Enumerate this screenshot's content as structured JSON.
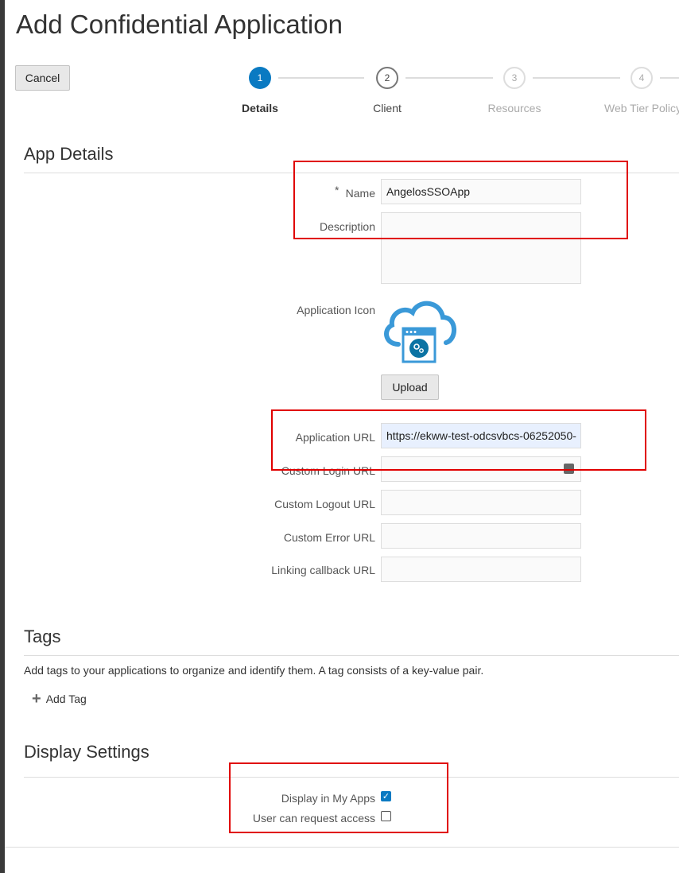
{
  "title": "Add Confidential Application",
  "cancel": "Cancel",
  "steps": [
    {
      "num": "1",
      "label": "Details"
    },
    {
      "num": "2",
      "label": "Client"
    },
    {
      "num": "3",
      "label": "Resources"
    },
    {
      "num": "4",
      "label": "Web Tier Policy"
    }
  ],
  "app_details": {
    "heading": "App Details",
    "name_label": "Name",
    "required": "*",
    "name_value": "AngelosSSOApp",
    "description_label": "Description",
    "icon_label": "Application Icon",
    "upload": "Upload",
    "app_url_label": "Application URL",
    "app_url_value": "https://ekww-test-odcsvbcs-06252050-",
    "login_url_label": "Custom Login URL",
    "logout_url_label": "Custom Logout URL",
    "error_url_label": "Custom Error URL",
    "linking_url_label": "Linking callback URL"
  },
  "tags": {
    "heading": "Tags",
    "description": "Add tags to your applications to organize and identify them. A tag consists of a key-value pair.",
    "add": "Add Tag"
  },
  "display": {
    "heading": "Display Settings",
    "my_apps_label": "Display in My Apps",
    "my_apps_checked": true,
    "request_label": "User can request access",
    "request_checked": false
  }
}
